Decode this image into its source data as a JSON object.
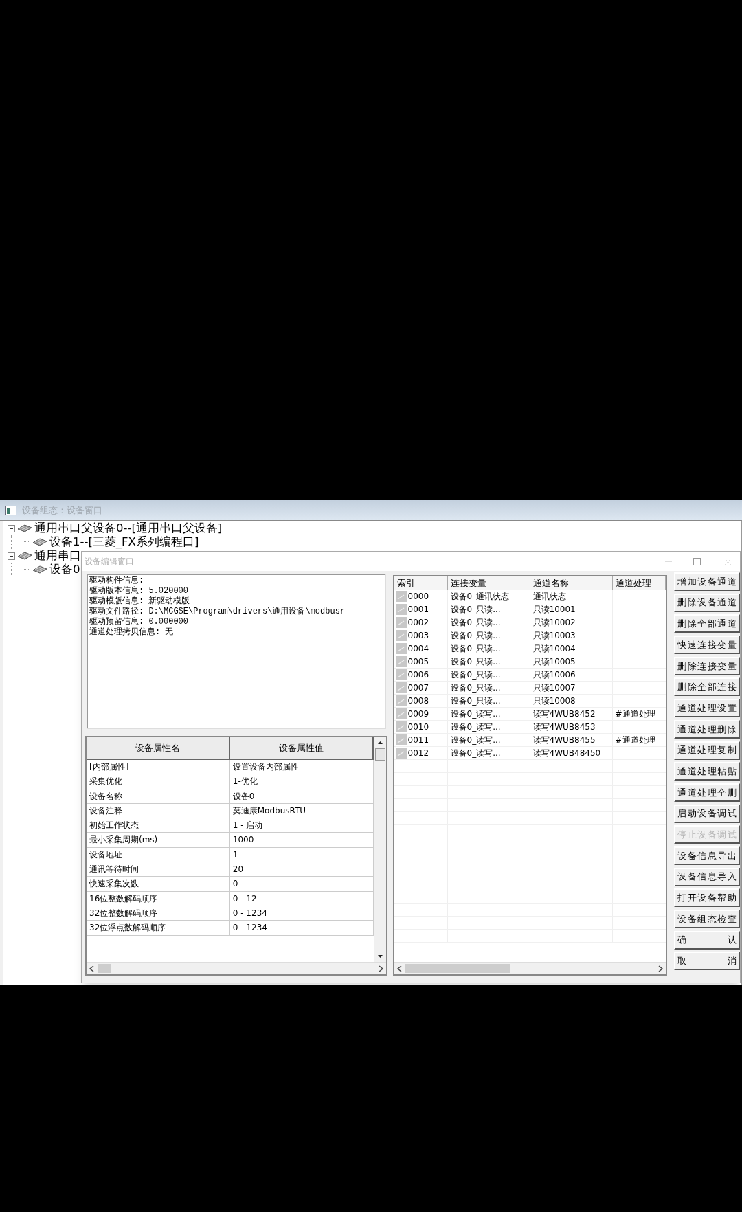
{
  "window": {
    "title": "设备组态：设备窗口"
  },
  "tree": [
    {
      "label": "通用串口父设备0--[通用串口父设备]",
      "expanded": true,
      "children": [
        {
          "label": "设备1--[三菱_FX系列编程口]"
        }
      ]
    },
    {
      "label": "通用串口",
      "expanded": true,
      "children": [
        {
          "label": "设备0"
        }
      ]
    }
  ],
  "dialog": {
    "title": "设备编辑窗口",
    "info_lines": [
      "驱动构件信息:",
      "驱动版本信息: 5.020000",
      "驱动模版信息: 新驱动模版",
      "驱动文件路径: D:\\MCGSE\\Program\\drivers\\通用设备\\modbusr",
      "驱动预留信息: 0.000000",
      "通道处理拷贝信息: 无"
    ],
    "property_table": {
      "columns": [
        "设备属性名",
        "设备属性值"
      ],
      "rows": [
        [
          "[内部属性]",
          "设置设备内部属性"
        ],
        [
          "采集优化",
          "1-优化"
        ],
        [
          "设备名称",
          "设备0"
        ],
        [
          "设备注释",
          "莫迪康ModbusRTU"
        ],
        [
          "初始工作状态",
          "1 - 启动"
        ],
        [
          "最小采集周期(ms)",
          "1000"
        ],
        [
          "设备地址",
          "1"
        ],
        [
          "通讯等待时间",
          "20"
        ],
        [
          "快速采集次数",
          "0"
        ],
        [
          "16位整数解码顺序",
          "0 - 12"
        ],
        [
          "32位整数解码顺序",
          "0 - 1234"
        ],
        [
          "32位浮点数解码顺序",
          "0 - 1234"
        ]
      ]
    },
    "channel_table": {
      "columns": [
        "索引",
        "连接变量",
        "通道名称",
        "通道处理"
      ],
      "rows": [
        {
          "index": "0000",
          "variable": "设备0_通讯状态",
          "name": "通讯状态"
        },
        {
          "index": "0001",
          "variable": "设备0_只读...",
          "name": "只读10001"
        },
        {
          "index": "0002",
          "variable": "设备0_只读...",
          "name": "只读10002"
        },
        {
          "index": "0003",
          "variable": "设备0_只读...",
          "name": "只读10003"
        },
        {
          "index": "0004",
          "variable": "设备0_只读...",
          "name": "只读10004"
        },
        {
          "index": "0005",
          "variable": "设备0_只读...",
          "name": "只读10005"
        },
        {
          "index": "0006",
          "variable": "设备0_只读...",
          "name": "只读10006"
        },
        {
          "index": "0007",
          "variable": "设备0_只读...",
          "name": "只读10007"
        },
        {
          "index": "0008",
          "variable": "设备0_只读...",
          "name": "只读10008"
        },
        {
          "index": "0009",
          "variable": "设备0_读写...",
          "name": "读写4WUB8452",
          "processing": "#通道处理"
        },
        {
          "index": "0010",
          "variable": "设备0_读写...",
          "name": "读写4WUB8453"
        },
        {
          "index": "0011",
          "variable": "设备0_读写...",
          "name": "读写4WUB8455",
          "processing": "#通道处理"
        },
        {
          "index": "0012",
          "variable": "设备0_读写...",
          "name": "读写4WUB48450"
        }
      ]
    },
    "buttons": [
      {
        "label": "增加设备通道",
        "disabled": false
      },
      {
        "label": "删除设备通道",
        "disabled": false
      },
      {
        "label": "删除全部通道",
        "disabled": false
      },
      {
        "label": "快速连接变量",
        "disabled": false
      },
      {
        "label": "删除连接变量",
        "disabled": false
      },
      {
        "label": "删除全部连接",
        "disabled": false
      },
      {
        "label": "通道处理设置",
        "disabled": false
      },
      {
        "label": "通道处理删除",
        "disabled": false
      },
      {
        "label": "通道处理复制",
        "disabled": false
      },
      {
        "label": "通道处理粘贴",
        "disabled": false
      },
      {
        "label": "通道处理全删",
        "disabled": false
      },
      {
        "label": "启动设备调试",
        "disabled": false
      },
      {
        "label": "停止设备调试",
        "disabled": true
      },
      {
        "label": "设备信息导出",
        "disabled": false
      },
      {
        "label": "设备信息导入",
        "disabled": false
      },
      {
        "label": "打开设备帮助",
        "disabled": false
      },
      {
        "label": "设备组态检查",
        "disabled": false
      },
      {
        "label": "确 认",
        "disabled": false
      },
      {
        "label": "取 消",
        "disabled": false
      }
    ]
  }
}
